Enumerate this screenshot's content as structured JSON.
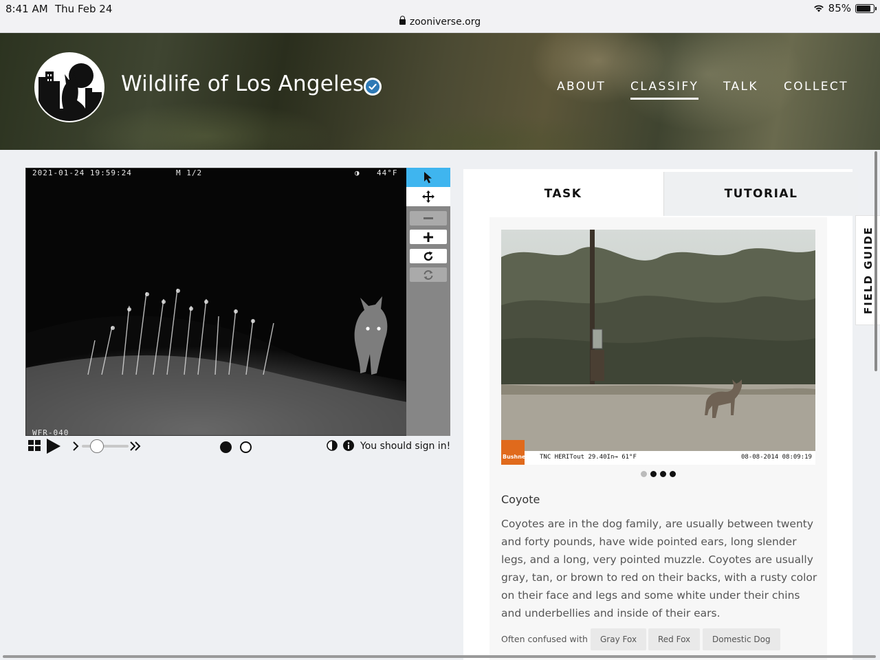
{
  "status_bar": {
    "time": "8:41 AM",
    "date": "Thu Feb 24",
    "url": "zooniverse.org",
    "battery": "85%"
  },
  "project": {
    "title": "Wildlife of Los Angeles",
    "nav": [
      "ABOUT",
      "CLASSIFY",
      "TALK",
      "COLLECT"
    ],
    "active_nav": "CLASSIFY"
  },
  "subject": {
    "timestamp": "2021-01-24 19:59:24",
    "frame": "M 1/2",
    "temperature": "44°F",
    "camera_id": "WFR-040",
    "sign_in_text": "You should sign in!"
  },
  "tools": [
    "pointer-icon",
    "move-icon",
    "zoom-out-icon",
    "zoom-in-icon",
    "rotate-icon",
    "reset-icon"
  ],
  "panel": {
    "tabs": [
      "TASK",
      "TUTORIAL"
    ],
    "active_tab": "TUTORIAL",
    "field_guide": "FIELD GUIDE",
    "example_caption_left": "TNC HERITout 29.40In→ 61°F",
    "example_caption_right": "08-08-2014 08:09:19",
    "example_brand": "Bushnell",
    "species": "Coyote",
    "description": "Coyotes are in the dog family, are usually between twenty and forty pounds, have wide pointed ears, long slender legs, and a long, very pointed muzzle. Coyotes are usually gray, tan, or brown to red on their backs, with a rusty color on their face and legs and some white under their chins and underbellies and inside of their ears.",
    "confused_label": "Often confused with",
    "confused_with": [
      "Gray Fox",
      "Red Fox",
      "Domestic Dog"
    ]
  },
  "colors": {
    "accent": "#3fb5ef",
    "toolbar": "#868686",
    "panel_bg": "#ffffff",
    "page_bg": "#eef0f3"
  }
}
